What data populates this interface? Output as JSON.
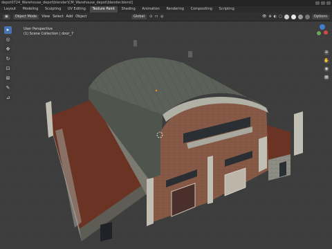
{
  "title_bar": {
    "text": "depot0724_Warehouse_depot\\blender\\CM_Warehouse_depot\\blender.blend]"
  },
  "workspaces": [
    "Layout",
    "Modeling",
    "Sculpting",
    "UV Editing",
    "Texture Paint",
    "Shading",
    "Animation",
    "Rendering",
    "Compositing",
    "Scripting"
  ],
  "active_workspace": "Texture Paint",
  "header": {
    "mode": "Object Mode",
    "menus": [
      "View",
      "Select",
      "Add",
      "Object"
    ],
    "transform_orientation": "Global",
    "options_label": "Options"
  },
  "viewport": {
    "perspective_label": "User Perspective",
    "collection_label": "(1) Scene Collection | door_7"
  },
  "tools": [
    "select-box",
    "cursor",
    "move",
    "rotate",
    "scale",
    "transform",
    "annotate",
    "measure"
  ],
  "colors": {
    "accent": "#4772b3",
    "grid": "#3d3d3d",
    "roof": "#5a6058",
    "brick": "#8a5c48",
    "floor": "#6b3324"
  }
}
